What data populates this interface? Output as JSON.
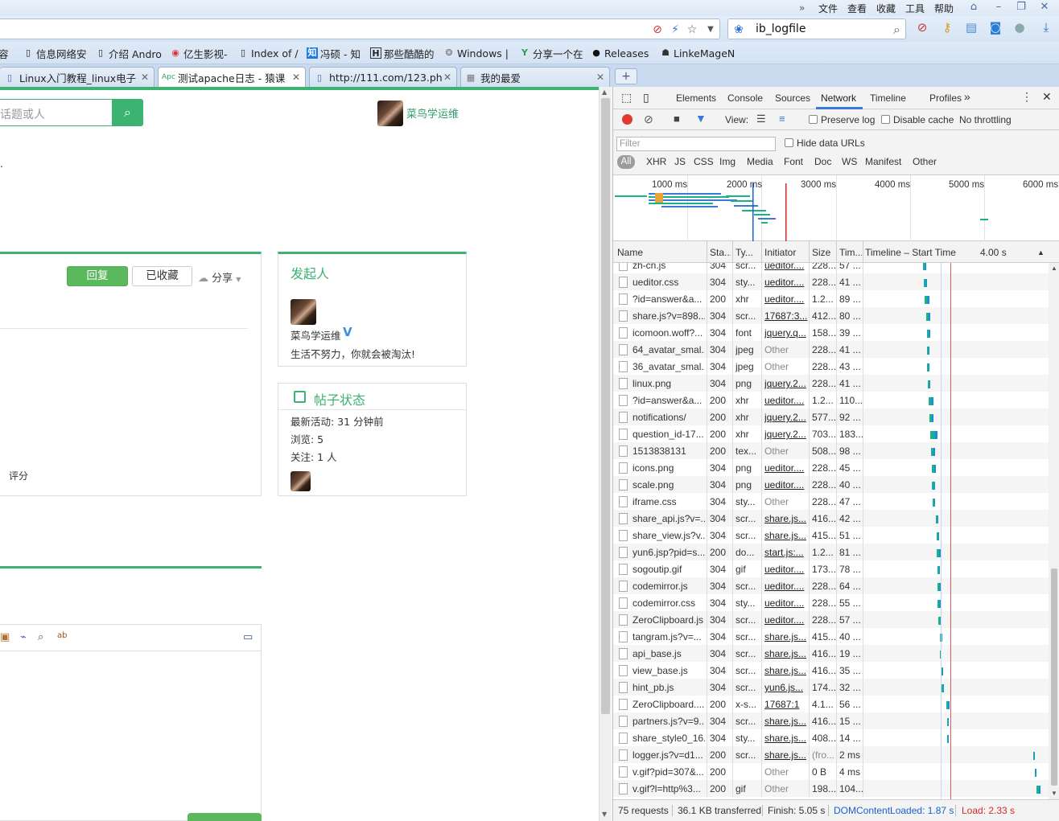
{
  "menubar": {
    "arrows": "»",
    "items": [
      "文件",
      "查看",
      "收藏",
      "工具",
      "帮助"
    ]
  },
  "address": {
    "search_text": "ib_logfile"
  },
  "favorites": [
    {
      "label": "容",
      "icon": ""
    },
    {
      "label": "信息网络安",
      "icon": "page-icon"
    },
    {
      "label": "介绍 Andro",
      "icon": "page-icon"
    },
    {
      "label": "亿生影视-",
      "icon": "play-icon"
    },
    {
      "label": "Index of /",
      "icon": "page-icon"
    },
    {
      "label": "冯硕 - 知",
      "icon": "zhihu-icon"
    },
    {
      "label": "那些酷酷的",
      "icon": "h-icon"
    },
    {
      "label": "Windows |",
      "icon": "windows-icon"
    },
    {
      "label": "分享一个在",
      "icon": "y-icon"
    },
    {
      "label": "Releases",
      "icon": "github-icon"
    },
    {
      "label": "LinkeMageN",
      "icon": "robot-icon"
    }
  ],
  "tabs": [
    {
      "label": "Linux入门教程_linux电子",
      "active": false
    },
    {
      "label": "测试apache日志 - 猿课",
      "active": true
    },
    {
      "label": "http://111.com/123.ph",
      "active": false
    },
    {
      "label": "我的最爱",
      "active": false
    }
  ],
  "page": {
    "search_placeholder": "话题或人",
    "top_user": "菜鸟学运维",
    "dot": ".",
    "reply_button": "回复",
    "collected_button": "已收藏",
    "share_label": "分享",
    "rating_label": "评分",
    "sponsor": {
      "title": "发起人",
      "name": "菜鸟学运维",
      "badge": "V",
      "motto": "生活不努力，你就会被淘汰!"
    },
    "post_status": {
      "title": "帖子状态",
      "last_active": "最新活动: 31 分钟前",
      "views": "浏览: 5",
      "follows": "关注: 1 人"
    }
  },
  "devtools": {
    "tabs": [
      "Elements",
      "Console",
      "Sources",
      "Network",
      "Timeline",
      "Profiles"
    ],
    "more": "»",
    "active_tab": "Network",
    "toolbar": {
      "view_label": "View:",
      "preserve_log": "Preserve log",
      "disable_cache": "Disable cache",
      "throttling": "No throttling"
    },
    "filter_placeholder": "Filter",
    "hide_data_urls": "Hide data URLs",
    "types": [
      "All",
      "XHR",
      "JS",
      "CSS",
      "Img",
      "Media",
      "Font",
      "Doc",
      "WS",
      "Manifest",
      "Other"
    ],
    "overview_ticks": [
      "1000 ms",
      "2000 ms",
      "3000 ms",
      "4000 ms",
      "5000 ms",
      "6000 ms"
    ],
    "columns": [
      "Name",
      "Sta...",
      "Ty...",
      "Initiator",
      "Size",
      "Tim...",
      "Timeline – Start Time"
    ],
    "timeline_scale": "4.00 s",
    "rows": [
      {
        "name": "zh-cn.js",
        "status": "304",
        "type": "scr...",
        "initiator": "ueditor....",
        "size": "228...",
        "time": "57 ...",
        "link": true
      },
      {
        "name": "ueditor.css",
        "status": "304",
        "type": "sty...",
        "initiator": "ueditor....",
        "size": "228...",
        "time": "41 ...",
        "link": true
      },
      {
        "name": "?id=answer&a...",
        "status": "200",
        "type": "xhr",
        "initiator": "ueditor....",
        "size": "1.2...",
        "time": "89 ...",
        "link": true
      },
      {
        "name": "share.js?v=898...",
        "status": "304",
        "type": "scr...",
        "initiator": "17687:3...",
        "size": "412...",
        "time": "80 ...",
        "link": true
      },
      {
        "name": "icomoon.woff?...",
        "status": "304",
        "type": "font",
        "initiator": "jquery.q...",
        "size": "158...",
        "time": "39 ...",
        "link": true
      },
      {
        "name": "64_avatar_smal...",
        "status": "304",
        "type": "jpeg",
        "initiator": "Other",
        "size": "228...",
        "time": "41 ...",
        "link": false
      },
      {
        "name": "36_avatar_smal...",
        "status": "304",
        "type": "jpeg",
        "initiator": "Other",
        "size": "228...",
        "time": "43 ...",
        "link": false
      },
      {
        "name": "linux.png",
        "status": "304",
        "type": "png",
        "initiator": "jquery.2...",
        "size": "228...",
        "time": "41 ...",
        "link": true
      },
      {
        "name": "?id=answer&a...",
        "status": "200",
        "type": "xhr",
        "initiator": "ueditor....",
        "size": "1.2...",
        "time": "110...",
        "link": true
      },
      {
        "name": "notifications/",
        "status": "200",
        "type": "xhr",
        "initiator": "jquery.2...",
        "size": "577...",
        "time": "92 ...",
        "link": true
      },
      {
        "name": "question_id-17...",
        "status": "200",
        "type": "xhr",
        "initiator": "jquery.2...",
        "size": "703...",
        "time": "183...",
        "link": true
      },
      {
        "name": "1513838131",
        "status": "200",
        "type": "tex...",
        "initiator": "Other",
        "size": "508...",
        "time": "98 ...",
        "link": false
      },
      {
        "name": "icons.png",
        "status": "304",
        "type": "png",
        "initiator": "ueditor....",
        "size": "228...",
        "time": "45 ...",
        "link": true
      },
      {
        "name": "scale.png",
        "status": "304",
        "type": "png",
        "initiator": "ueditor....",
        "size": "228...",
        "time": "40 ...",
        "link": true
      },
      {
        "name": "iframe.css",
        "status": "304",
        "type": "sty...",
        "initiator": "Other",
        "size": "228...",
        "time": "47 ...",
        "link": false
      },
      {
        "name": "share_api.js?v=...",
        "status": "304",
        "type": "scr...",
        "initiator": "share.js...",
        "size": "416...",
        "time": "42 ...",
        "link": true
      },
      {
        "name": "share_view.js?v...",
        "status": "304",
        "type": "scr...",
        "initiator": "share.js...",
        "size": "415...",
        "time": "51 ...",
        "link": true
      },
      {
        "name": "yun6.jsp?pid=s...",
        "status": "200",
        "type": "do...",
        "initiator": "start.js:...",
        "size": "1.2...",
        "time": "81 ...",
        "link": true
      },
      {
        "name": "sogoutip.gif",
        "status": "304",
        "type": "gif",
        "initiator": "ueditor....",
        "size": "173...",
        "time": "78 ...",
        "link": true
      },
      {
        "name": "codemirror.js",
        "status": "304",
        "type": "scr...",
        "initiator": "ueditor....",
        "size": "228...",
        "time": "64 ...",
        "link": true
      },
      {
        "name": "codemirror.css",
        "status": "304",
        "type": "sty...",
        "initiator": "ueditor....",
        "size": "228...",
        "time": "55 ...",
        "link": true
      },
      {
        "name": "ZeroClipboard.js",
        "status": "304",
        "type": "scr...",
        "initiator": "ueditor....",
        "size": "228...",
        "time": "57 ...",
        "link": true
      },
      {
        "name": "tangram.js?v=...",
        "status": "304",
        "type": "scr...",
        "initiator": "share.js...",
        "size": "415...",
        "time": "40 ...",
        "link": true
      },
      {
        "name": "api_base.js",
        "status": "304",
        "type": "scr...",
        "initiator": "share.js...",
        "size": "416...",
        "time": "19 ...",
        "link": true
      },
      {
        "name": "view_base.js",
        "status": "304",
        "type": "scr...",
        "initiator": "share.js...",
        "size": "416...",
        "time": "35 ...",
        "link": true
      },
      {
        "name": "hint_pb.js",
        "status": "304",
        "type": "scr...",
        "initiator": "yun6.js...",
        "size": "174...",
        "time": "32 ...",
        "link": true
      },
      {
        "name": "ZeroClipboard....",
        "status": "200",
        "type": "x-s...",
        "initiator": "17687:1",
        "size": "4.1...",
        "time": "56 ...",
        "link": true
      },
      {
        "name": "partners.js?v=9...",
        "status": "304",
        "type": "scr...",
        "initiator": "share.js...",
        "size": "416...",
        "time": "15 ...",
        "link": true
      },
      {
        "name": "share_style0_16...",
        "status": "304",
        "type": "sty...",
        "initiator": "share.js...",
        "size": "408...",
        "time": "14 ...",
        "link": true
      },
      {
        "name": "logger.js?v=d1...",
        "status": "200",
        "type": "scr...",
        "initiator": "share.js...",
        "size": "(fro...",
        "time": "2 ms",
        "link": true
      },
      {
        "name": "v.gif?pid=307&...",
        "status": "200",
        "type": "",
        "initiator": "Other",
        "size": "0 B",
        "time": "4 ms",
        "link": false
      },
      {
        "name": "v.gif?l=http%3...",
        "status": "200",
        "type": "gif",
        "initiator": "Other",
        "size": "198...",
        "time": "104...",
        "link": false
      }
    ],
    "status_bar": {
      "requests": "75 requests",
      "transferred": "36.1 KB transferred",
      "finish": "Finish: 5.05 s",
      "dcl": "DOMContentLoaded: 1.87 s",
      "load": "Load: 2.33 s"
    },
    "colors": {
      "accent": "#3879d9",
      "dcl": "#1a5fd0",
      "load": "#d22a2a",
      "waiting": "#19b28a",
      "download": "#1e88e5"
    }
  }
}
